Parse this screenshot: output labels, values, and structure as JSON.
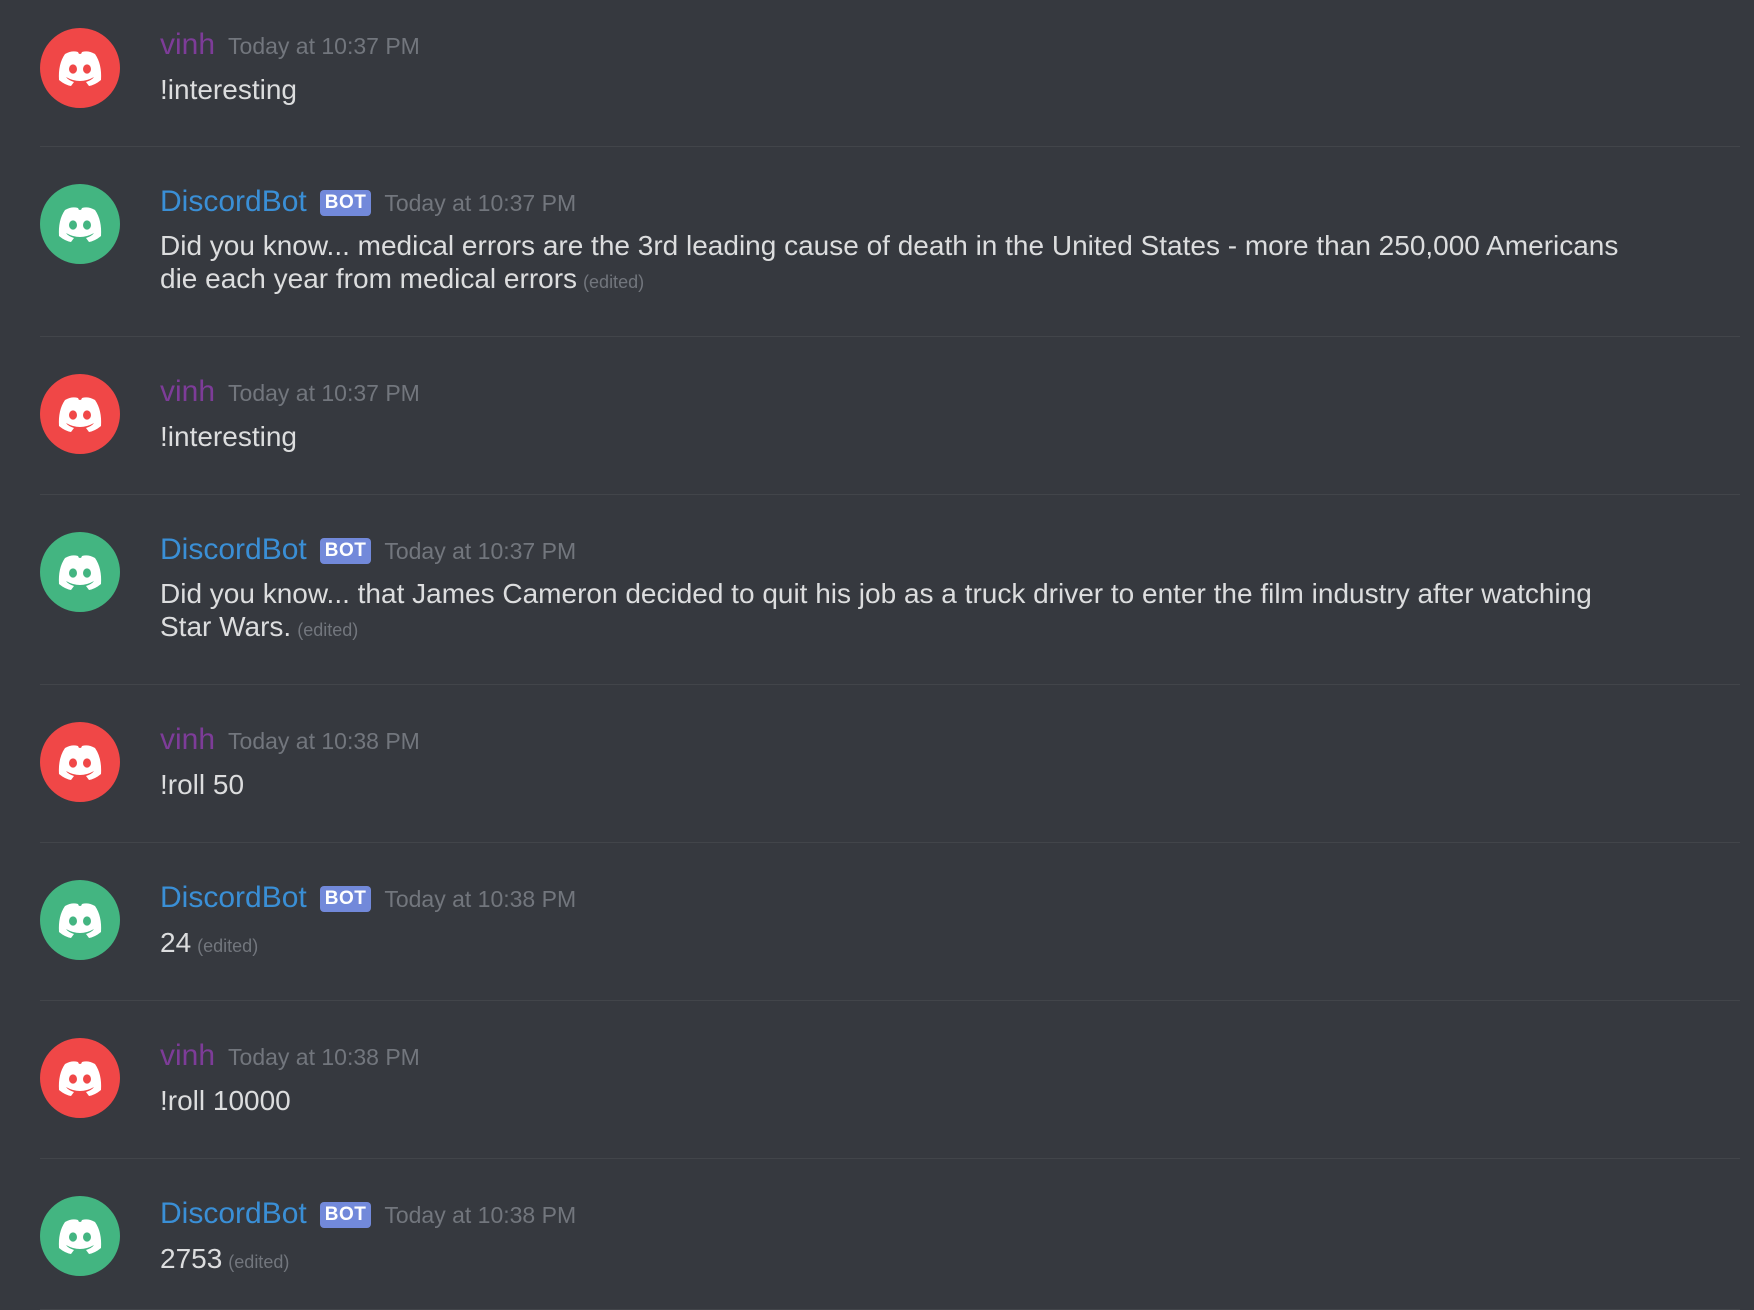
{
  "messages": [
    {
      "author": "vinh",
      "bot": false,
      "timestamp": "Today at 10:37 PM",
      "lines": [
        "!interesting"
      ],
      "edited": ""
    },
    {
      "author": "DiscordBot",
      "bot": true,
      "bot_tag": "BOT",
      "timestamp": "Today at 10:37 PM",
      "lines": [
        "Did you know... medical errors are the 3rd leading cause of death in the United States - more than 250,000 Americans",
        "die each year from medical errors"
      ],
      "edited": "(edited)"
    },
    {
      "author": "vinh",
      "bot": false,
      "timestamp": "Today at 10:37 PM",
      "lines": [
        "!interesting"
      ],
      "edited": ""
    },
    {
      "author": "DiscordBot",
      "bot": true,
      "bot_tag": "BOT",
      "timestamp": "Today at 10:37 PM",
      "lines": [
        "Did you know... that James Cameron decided to quit his job as a truck driver to enter the film industry after watching",
        "Star Wars."
      ],
      "edited": "(edited)"
    },
    {
      "author": "vinh",
      "bot": false,
      "timestamp": "Today at 10:38 PM",
      "lines": [
        "!roll 50"
      ],
      "edited": ""
    },
    {
      "author": "DiscordBot",
      "bot": true,
      "bot_tag": "BOT",
      "timestamp": "Today at 10:38 PM",
      "lines": [
        "24"
      ],
      "edited": "(edited)"
    },
    {
      "author": "vinh",
      "bot": false,
      "timestamp": "Today at 10:38 PM",
      "lines": [
        "!roll 10000"
      ],
      "edited": ""
    },
    {
      "author": "DiscordBot",
      "bot": true,
      "bot_tag": "BOT",
      "timestamp": "Today at 10:38 PM",
      "lines": [
        "2753"
      ],
      "edited": "(edited)"
    }
  ],
  "colors": {
    "background": "#36393f",
    "vinh_name": "#7d3c98",
    "bot_name": "#3a8fd6",
    "bot_tag": "#7289da",
    "vinh_avatar": "#f04747",
    "bot_avatar": "#43b581",
    "timestamp": "#72767d"
  },
  "icons": {
    "avatar": "discord-logo-icon"
  }
}
